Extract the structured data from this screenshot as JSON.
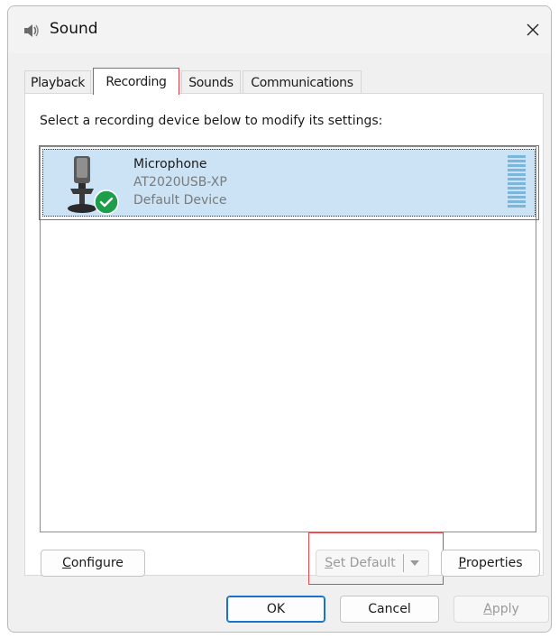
{
  "window": {
    "title": "Sound",
    "icon": "speaker-icon",
    "close_icon": "close-icon"
  },
  "tabs": [
    {
      "label": "Playback",
      "active": false
    },
    {
      "label": "Recording",
      "active": true
    },
    {
      "label": "Sounds",
      "active": false
    },
    {
      "label": "Communications",
      "active": false
    }
  ],
  "recording": {
    "instruction": "Select a recording device below to modify its settings:",
    "devices": [
      {
        "name": "Microphone",
        "model": "AT2020USB-XP",
        "status": "Default Device",
        "icon": "microphone-icon",
        "badge_icon": "check-badge-icon",
        "selected": true
      }
    ]
  },
  "panel_buttons": {
    "configure": {
      "pre": "",
      "underlined": "C",
      "post": "onfigure"
    },
    "set_default": {
      "pre": "",
      "underlined": "S",
      "post": "et Default",
      "enabled": false
    },
    "properties": {
      "pre": "",
      "underlined": "P",
      "post": "roperties"
    }
  },
  "dialog_buttons": {
    "ok": "OK",
    "cancel": "Cancel",
    "apply": {
      "pre": "",
      "underlined": "A",
      "post": "pply",
      "enabled": false
    }
  },
  "colors": {
    "selection": "#cce3f5",
    "highlight_outline": "#e0474c",
    "check_badge": "#1f9e4a",
    "level_meter": "#7bb7dd"
  }
}
